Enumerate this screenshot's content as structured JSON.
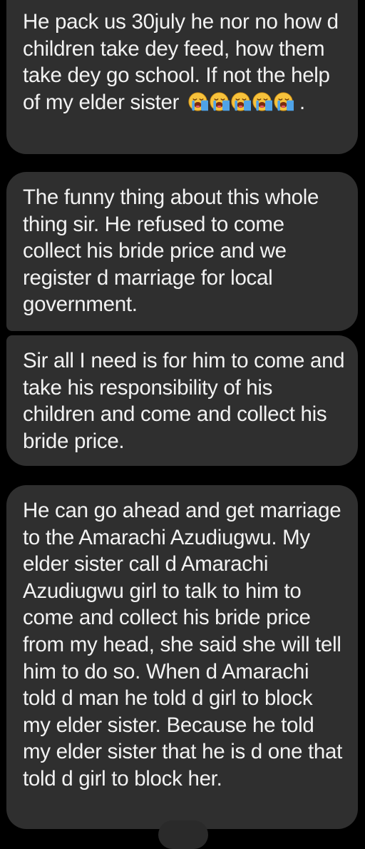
{
  "messages": [
    {
      "text": "He pack us 30july he nor no how d children take dey feed, how them take dey go school. If not the help of my elder sister",
      "emojis": [
        "loudly-crying-face",
        "loudly-crying-face",
        "loudly-crying-face",
        "loudly-crying-face",
        "loudly-crying-face"
      ],
      "suffix": "."
    },
    {
      "text": "The funny thing about this whole thing sir. He refused to come collect his bride price and we register d marriage for local government."
    },
    {
      "text": "Sir all I need is for him to come and take his responsibility of his children and come and collect his bride price."
    },
    {
      "text": "He can go ahead and get marriage to the Amarachi Azudiugwu. My elder sister call d Amarachi Azudiugwu girl to talk to him to come and collect his bride price from my head, she said she will tell him to do so. When d Amarachi told d man he told d girl to block my elder sister. Because he told my elder sister that he is d one that told d girl to block her."
    }
  ],
  "colors": {
    "background": "#000000",
    "bubble": "#2f2f2f",
    "text": "#f2f2f2"
  }
}
